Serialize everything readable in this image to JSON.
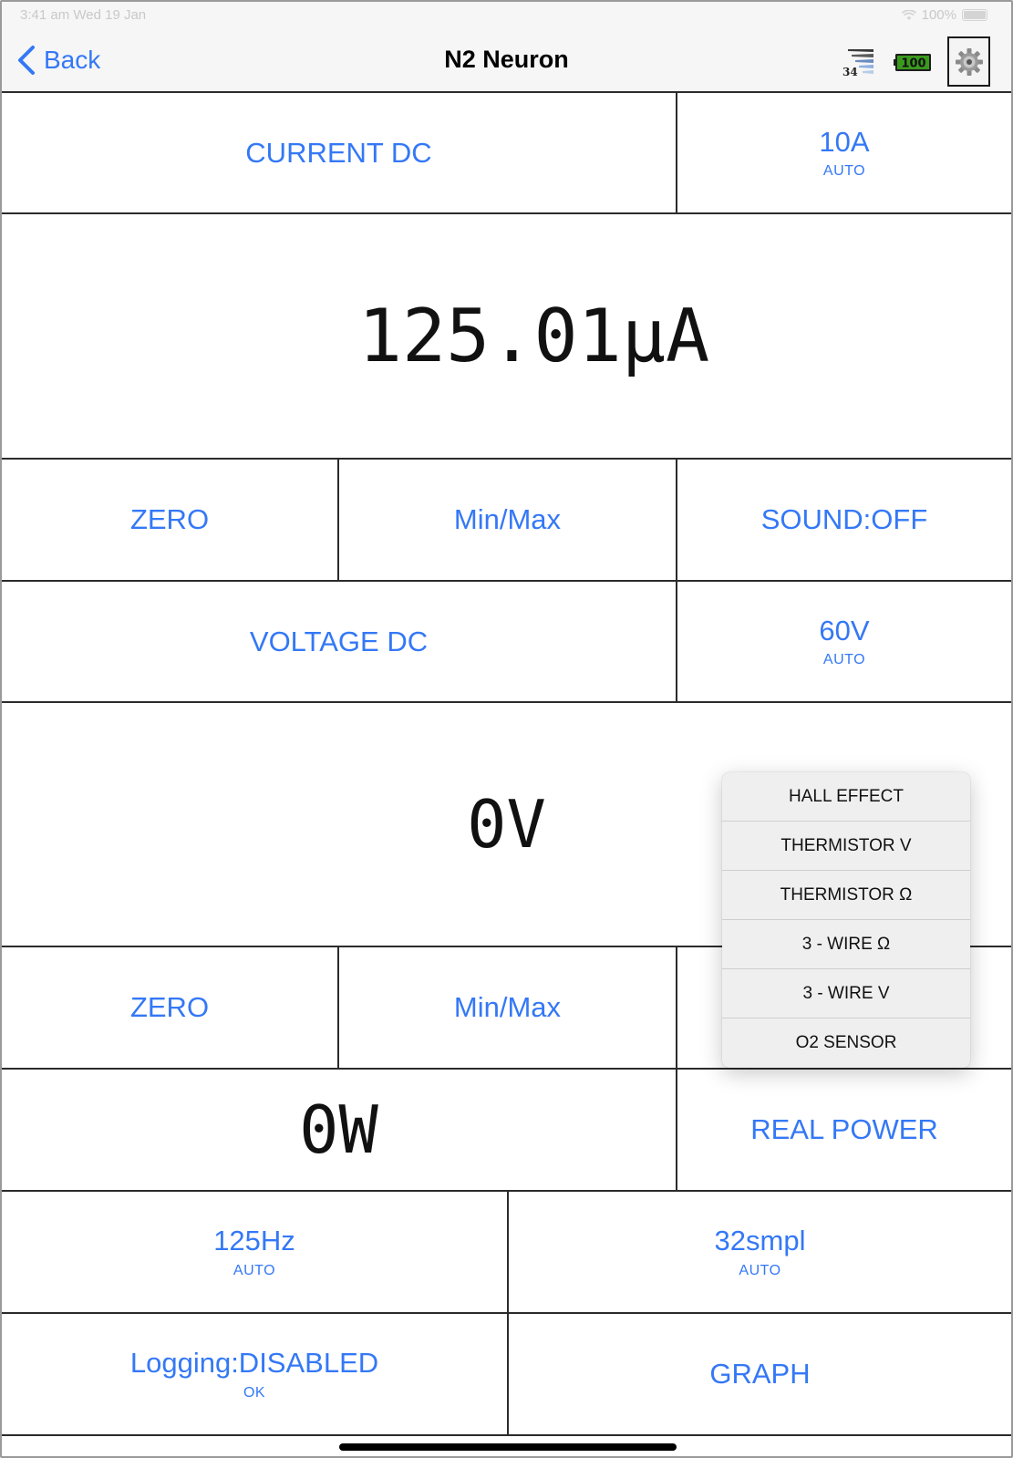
{
  "status_bar": {
    "time": "3:41 am   Wed 19 Jan",
    "battery_text": "100%"
  },
  "nav": {
    "back_label": "Back",
    "title": "N2 Neuron",
    "signal_number": "34",
    "battery_level": "100"
  },
  "channel1": {
    "function": "CURRENT DC",
    "range": "10A",
    "range_mode": "AUTO",
    "reading": "125.01µA",
    "zero_label": "ZERO",
    "minmax_label": "Min/Max",
    "sound_label": "SOUND:OFF"
  },
  "channel2": {
    "function": "VOLTAGE DC",
    "range": "60V",
    "range_mode": "AUTO",
    "reading": "0V",
    "zero_label": "ZERO",
    "minmax_label": "Min/Max"
  },
  "power": {
    "reading": "0W",
    "mode_label": "REAL POWER"
  },
  "sampling": {
    "rate": "125Hz",
    "rate_mode": "AUTO",
    "samples": "32smpl",
    "samples_mode": "AUTO"
  },
  "logging": {
    "label": "Logging:DISABLED",
    "status": "OK",
    "graph_label": "GRAPH"
  },
  "popover": {
    "items": [
      "HALL EFFECT",
      "THERMISTOR V",
      "THERMISTOR Ω",
      "3 - WIRE Ω",
      "3 - WIRE V",
      "O2 SENSOR"
    ]
  },
  "colors": {
    "accent": "#3478f6",
    "grid_line": "#2b2b2b",
    "battery_green": "#3a9a1e"
  },
  "icons": {
    "back": "chevron-left-icon",
    "signal": "signal-strength-icon",
    "battery": "battery-icon",
    "settings": "gear-icon"
  }
}
